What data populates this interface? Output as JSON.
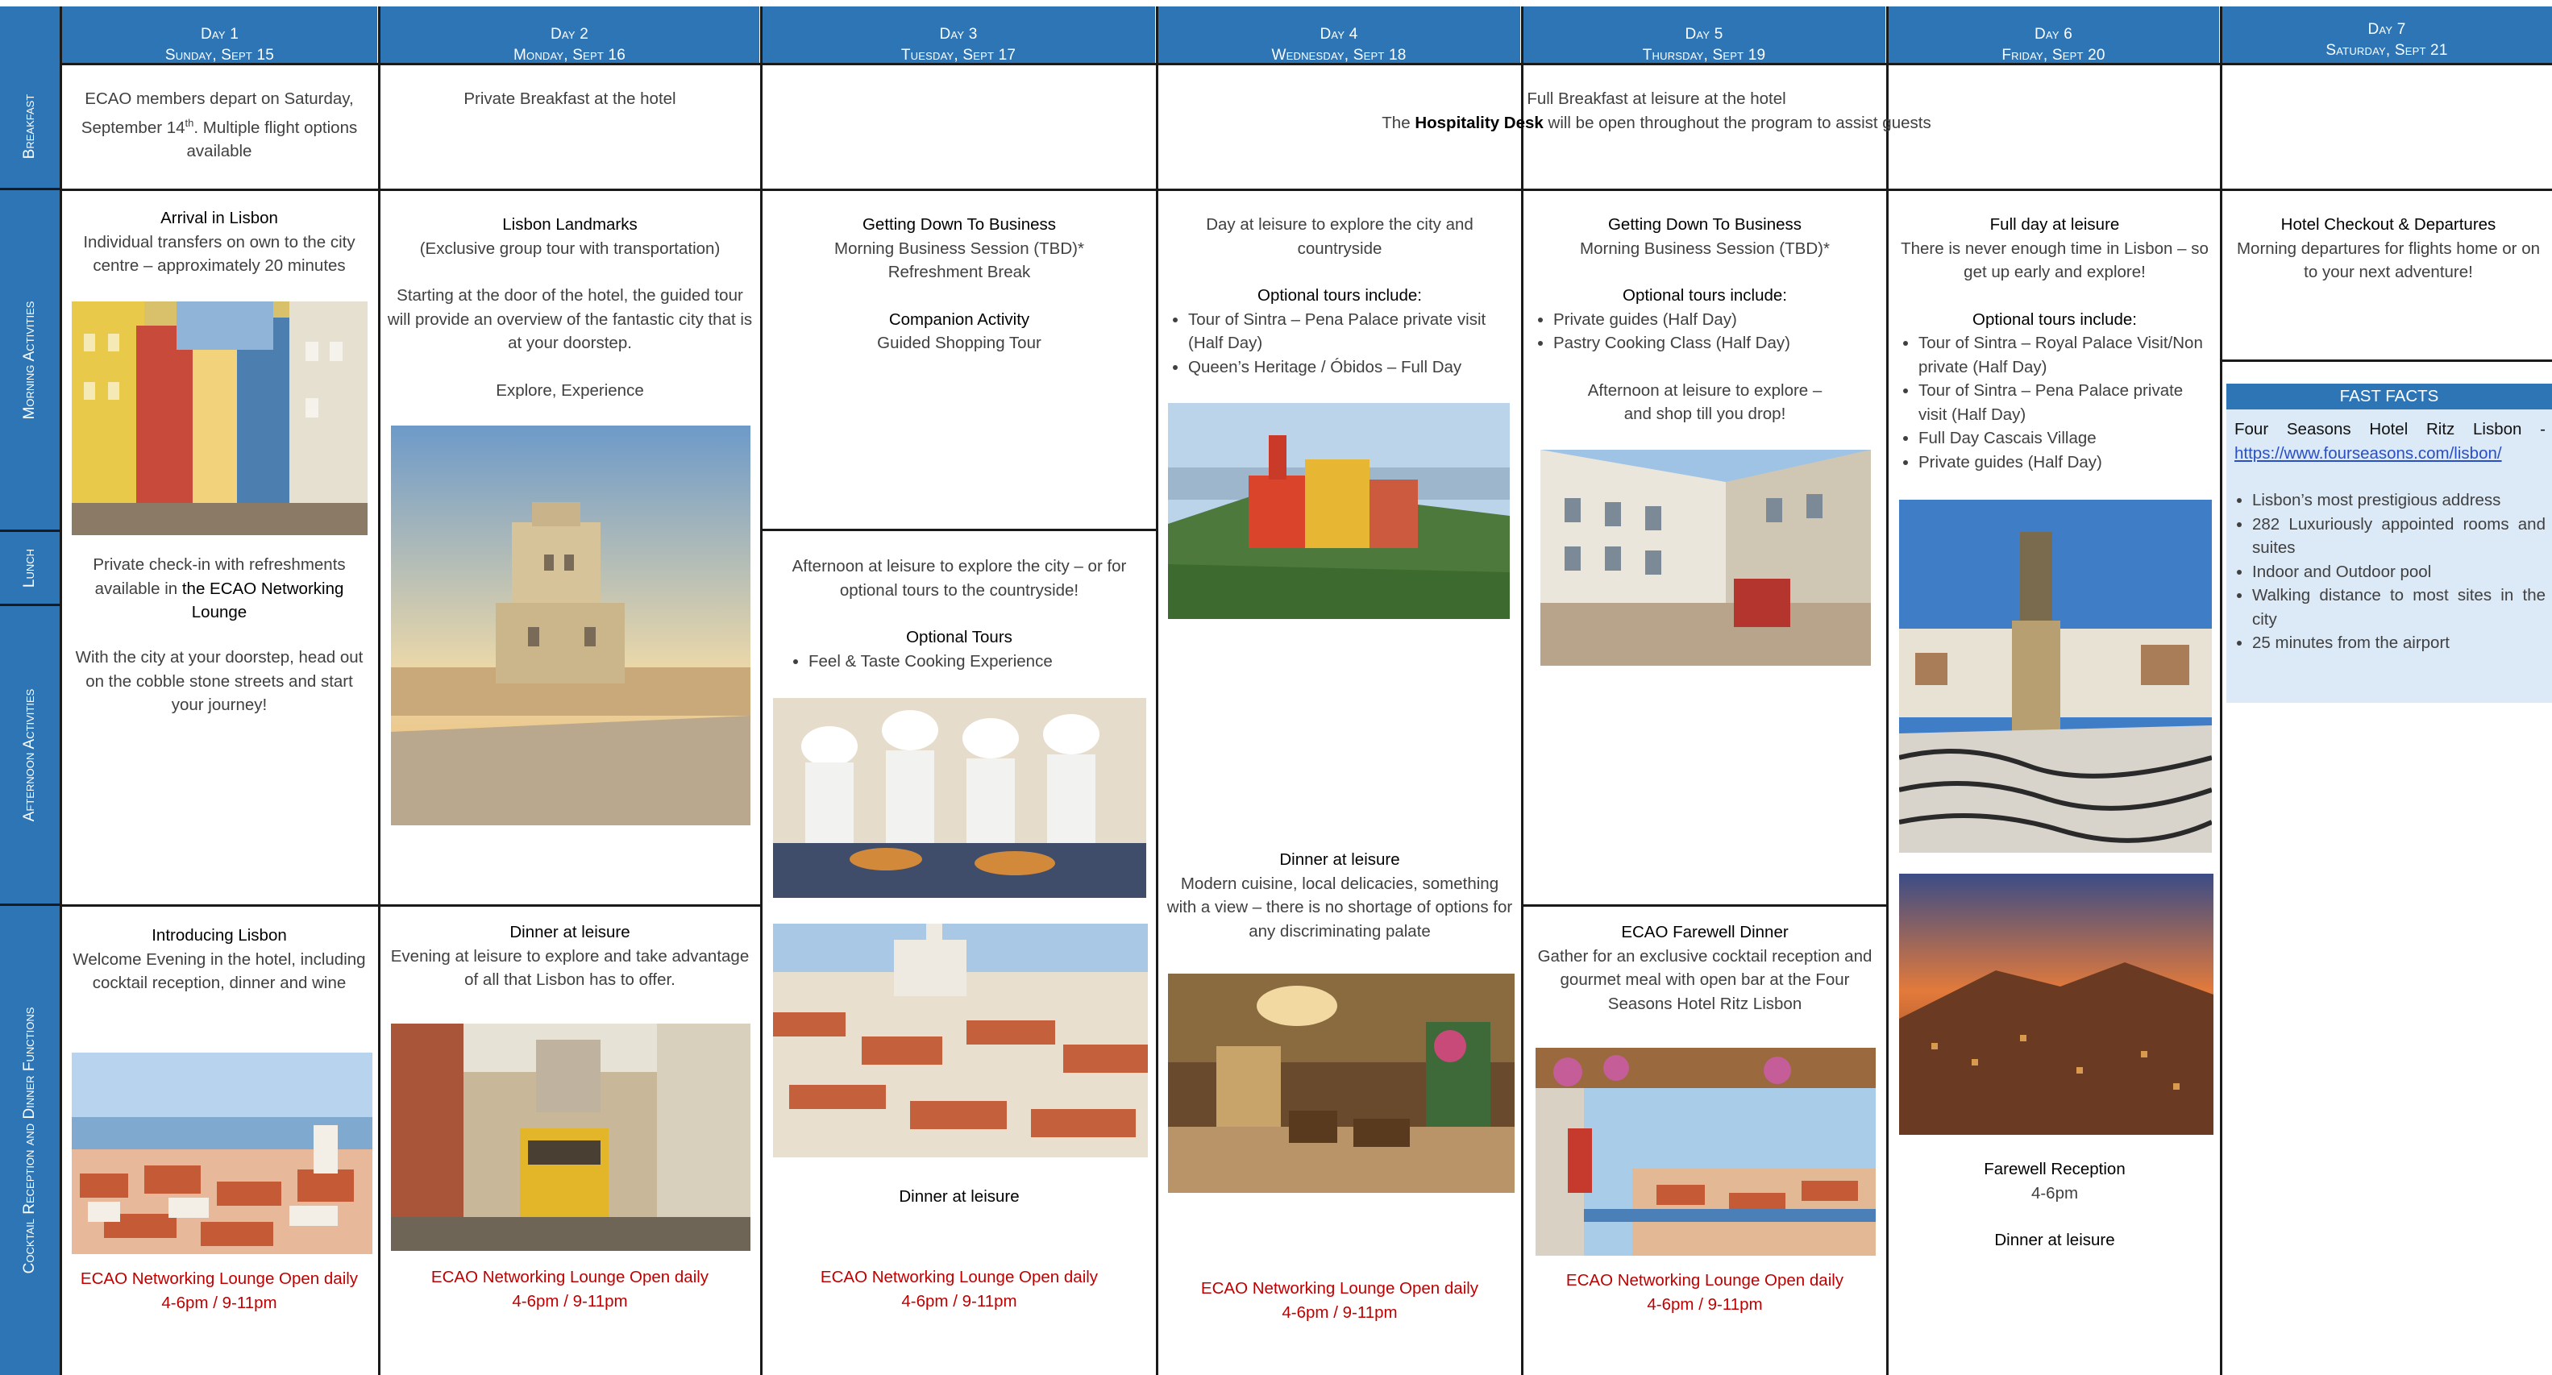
{
  "header": {
    "days": [
      {
        "day": "Day 1",
        "date": "Sunday, Sept 15"
      },
      {
        "day": "Day 2",
        "date": "Monday, Sept 16"
      },
      {
        "day": "Day 3",
        "date": "Tuesday, Sept 17"
      },
      {
        "day": "Day 4",
        "date": "Wednesday, Sept 18"
      },
      {
        "day": "Day 5",
        "date": "Thursday, Sept 19"
      },
      {
        "day": "Day 6",
        "date": "Friday, Sept 20"
      },
      {
        "day": "Day 7",
        "date": "Saturday, Sept 21"
      }
    ]
  },
  "rows": {
    "breakfast": "Breakfast",
    "morning": "Morning Activities",
    "lunch": "Lunch",
    "afternoon": "Afternoon Activities",
    "evening": "Cocktail Reception and Dinner Functions"
  },
  "breakfast": {
    "day1_a": "ECAO members depart on Saturday, September 14",
    "day1_sup": "th",
    "day1_b": ". Multiple flight options available",
    "day2": "Private Breakfast at the hotel",
    "rest_line1": "Full Breakfast at leisure at the hotel",
    "rest_line2_pre": "The ",
    "rest_line2_bold": "Hospitality Desk",
    "rest_line2_post": " will be open throughout the program to assist guests"
  },
  "day1": {
    "m_title": "Arrival in Lisbon",
    "m_body": "Individual transfers on own to the city centre – approximately 20 minutes",
    "lunch_pre": "Private check-in with refreshments available in ",
    "lunch_bold": "the ECAO Networking Lounge",
    "afternoon": "With the city at your doorstep, head out on the cobble stone streets and start your journey!",
    "e_title": "Introducing Lisbon",
    "e_body": "Welcome Evening in the hotel, including cocktail reception, dinner and wine",
    "lounge1": "ECAO Networking Lounge Open daily",
    "lounge2": "4-6pm / 9-11pm"
  },
  "day2": {
    "m_title": "Lisbon Landmarks",
    "m_sub": "(Exclusive group tour with transportation)",
    "m_body": "Starting at the door of the hotel, the guided tour will provide an overview of the fantastic city that is at your doorstep.",
    "m_tag": "Explore, Experience",
    "e_title": "Dinner at leisure",
    "e_body": "Evening at leisure to explore and take advantage of all that Lisbon has to offer.",
    "lounge1": "ECAO Networking Lounge Open daily",
    "lounge2": "4-6pm / 9-11pm"
  },
  "day3": {
    "m_title": "Getting Down To Business",
    "m_l1": "Morning Business Session  (TBD)*",
    "m_l2": "Refreshment Break",
    "m_comp": "Companion Activity",
    "m_comp2": "Guided Shopping Tour",
    "a_body": "Afternoon at leisure to explore the city – or for optional tours to the countryside!",
    "a_title": "Optional Tours",
    "a_item": "Feel & Taste Cooking Experience",
    "e_title": "Dinner at leisure",
    "lounge1": "ECAO Networking Lounge Open daily",
    "lounge2": "4-6pm / 9-11pm"
  },
  "day4": {
    "m_body": "Day at leisure to explore the city and countryside",
    "m_opt": "Optional tours include:",
    "m_items": [
      "Tour of Sintra – Pena Palace private visit (Half Day)",
      "Queen’s Heritage /  Óbidos – Full Day"
    ],
    "e_title": "Dinner at leisure",
    "e_body": "Modern cuisine, local delicacies, something with a view – there is no shortage of options for any discriminating palate",
    "lounge1": "ECAO Networking Lounge Open daily",
    "lounge2": "4-6pm / 9-11pm"
  },
  "day5": {
    "m_title": "Getting Down To Business",
    "m_l1": "Morning Business Session  (TBD)*",
    "m_opt": "Optional tours include:",
    "m_items": [
      "Private guides (Half Day)",
      "Pastry Cooking Class (Half Day)"
    ],
    "a_body": "Afternoon at leisure to explore – and shop till you drop!",
    "e_title": "ECAO Farewell Dinner",
    "e_body": "Gather for an exclusive cocktail reception and gourmet meal with open bar at the Four Seasons Hotel Ritz Lisbon",
    "lounge1": "ECAO Networking Lounge Open daily",
    "lounge2": "4-6pm / 9-11pm"
  },
  "day6": {
    "m_title": "Full day at leisure",
    "m_body": "There is never enough time in Lisbon – so get up early and explore!",
    "m_opt": "Optional tours include:",
    "m_items": [
      "Tour of Sintra – Royal Palace Visit/Non private (Half Day)",
      "Tour of Sintra – Pena Palace private visit (Half Day)",
      "Full Day Cascais Village",
      "Private guides (Half Day)"
    ],
    "e_title": "Farewell Reception",
    "e_time": "4-6pm",
    "e_dinner": "Dinner at leisure"
  },
  "day7": {
    "m_title": "Hotel Checkout & Departures",
    "m_body": "Morning departures for flights home or on to your next adventure!",
    "facts_title": "FAST FACTS",
    "facts_hotel": "Four Seasons Hotel Ritz Lisbon -",
    "facts_link": "https://www.fourseasons.com/lisbon/",
    "facts_items": [
      "Lisbon’s most prestigious address",
      "282 Luxuriously appointed rooms and suites",
      "Indoor and Outdoor pool",
      "Walking distance to most sites in the city",
      "25 minutes from the airport"
    ]
  },
  "colors": {
    "header_blue": "#2e75b6",
    "lounge_red": "#c00000",
    "facts_bg": "#dce9f6"
  },
  "photos": [
    "colorful-lisbon-street-photo",
    "belem-tower-photo",
    "pena-palace-photo",
    "lisbon-shopping-street-photo",
    "lisbon-statue-square-photo",
    "cooking-class-photo",
    "alfama-rooftops-photo",
    "hotel-lobby-photo",
    "tram-street-photo",
    "sunset-city-photo",
    "terrace-view-photo",
    "lisbon-panorama-photo"
  ]
}
